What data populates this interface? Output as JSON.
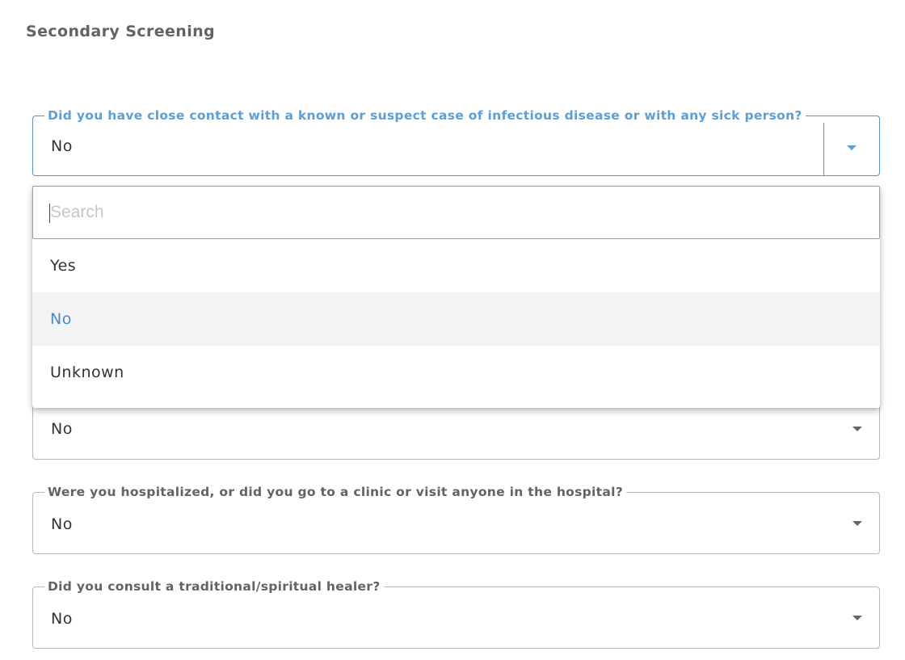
{
  "section": {
    "title": "Secondary Screening"
  },
  "fields": [
    {
      "label": "Did you have close contact with a known or suspect case of infectious disease or with any sick person?",
      "value": "No"
    },
    {
      "label": "",
      "value": "No"
    },
    {
      "label": "Were you hospitalized, or did you go to a clinic or visit anyone in the hospital?",
      "value": "No"
    },
    {
      "label": "Did you consult a traditional/spiritual healer?",
      "value": "No"
    }
  ],
  "dropdown": {
    "search_placeholder": "Search",
    "options": [
      "Yes",
      "No",
      "Unknown"
    ],
    "selected": "No"
  },
  "colors": {
    "accent": "#5b9fd6",
    "selected_text": "#4a88c8",
    "label_gray": "#636363"
  },
  "icons": {
    "caret": "chevron-down-icon"
  }
}
